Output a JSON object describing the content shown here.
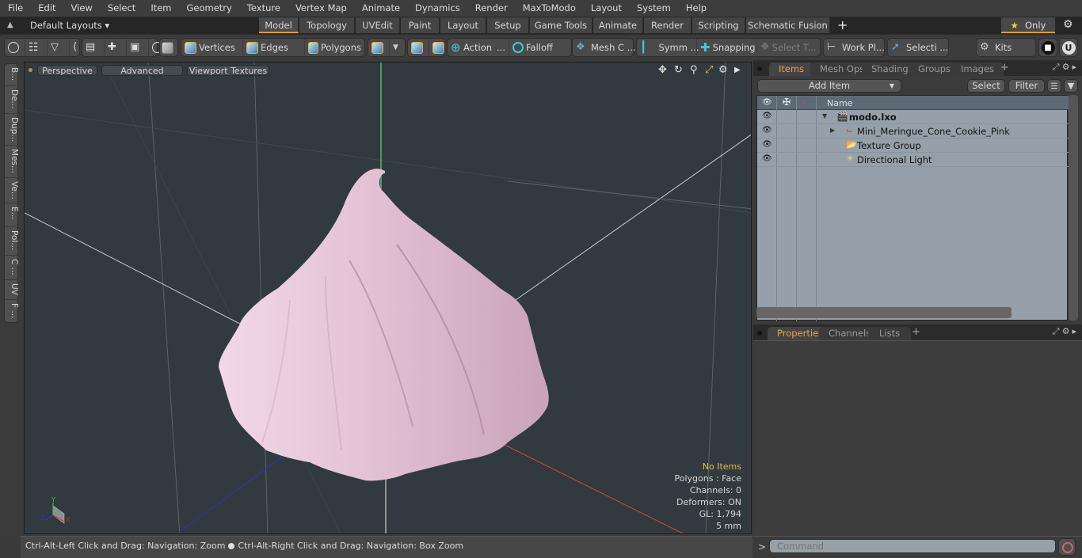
{
  "menu": [
    "File",
    "Edit",
    "View",
    "Select",
    "Item",
    "Geometry",
    "Texture",
    "Vertex Map",
    "Animate",
    "Dynamics",
    "Render",
    "MaxToModo",
    "Layout",
    "System",
    "Help"
  ],
  "layout_bar": {
    "layouts_label": "Default Layouts ▾",
    "tabs": [
      {
        "label": "Model",
        "active": true
      },
      {
        "label": "Topology"
      },
      {
        "label": "UVEdit"
      },
      {
        "label": "Paint"
      },
      {
        "label": "Layout"
      },
      {
        "label": "Setup"
      },
      {
        "label": "Game Tools"
      },
      {
        "label": "Animate"
      },
      {
        "label": "Render"
      },
      {
        "label": "Scripting"
      },
      {
        "label": "Schematic Fusion"
      }
    ],
    "add_tab": "+",
    "only_label": "Only",
    "accent_color": "#e49a35"
  },
  "toolbar": {
    "vertices": "Vertices",
    "edges": "Edges",
    "polygons": "Polygons",
    "action": "Action",
    "action_more": "...",
    "falloff": "Falloff",
    "mesh_c": "Mesh C ...",
    "symm": "Symm ...",
    "snapping": "Snapping",
    "select_t": "Select T...",
    "work_pl": "Work Pl...",
    "selecti": "Selecti ...",
    "kits": "Kits"
  },
  "left_tabs": [
    "B...",
    "De...",
    "Dup...",
    "Mes...",
    "Ve...",
    "E...",
    "Pol...",
    "C ...",
    "UV",
    "F ..."
  ],
  "viewport": {
    "buttons": [
      "Perspective",
      "Advanced",
      "Viewport Textures"
    ],
    "info": {
      "selection": "No Items",
      "polygons": "Polygons : Face",
      "channels": "Channels: 0",
      "deformers": "Deformers: ON",
      "gl": "GL: 1,794",
      "scale": "5 mm"
    },
    "axis_labels": {
      "x": "X",
      "y": "Y",
      "z": "Z"
    },
    "mesh_color": "#e6c8d8"
  },
  "status": {
    "left": "Ctrl-Alt-Left Click and Drag: Navigation: Zoom",
    "right": "Ctrl-Alt-Right Click and Drag: Navigation: Box Zoom"
  },
  "items_panel": {
    "tabs": [
      {
        "label": "Items",
        "active": true
      },
      {
        "label": "Mesh Ops"
      },
      {
        "label": "Shading"
      },
      {
        "label": "Groups"
      },
      {
        "label": "Images"
      }
    ],
    "add_item": "Add Item",
    "select": "Select",
    "filter": "Filter",
    "column_name": "Name",
    "tree": [
      {
        "label": "modo.lxo",
        "icon": "scene-icon",
        "bold": true
      },
      {
        "label": "Mini_Meringue_Cone_Cookie_Pink",
        "icon": "mesh-locator-icon"
      },
      {
        "label": "Texture Group",
        "icon": "folder-icon"
      },
      {
        "label": "Directional Light",
        "icon": "light-icon"
      }
    ]
  },
  "properties_panel": {
    "tabs": [
      {
        "label": "Properties",
        "active": true
      },
      {
        "label": "Channels"
      },
      {
        "label": "Lists"
      }
    ]
  },
  "command": {
    "prompt": ">",
    "placeholder": "Command"
  }
}
